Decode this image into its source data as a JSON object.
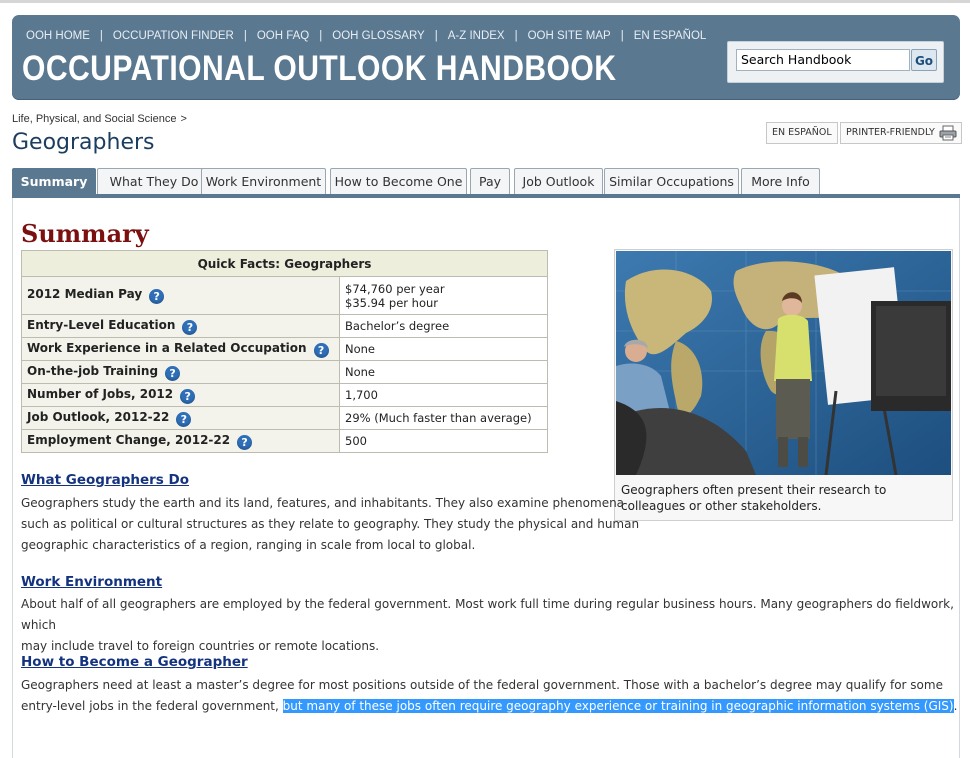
{
  "header": {
    "nav": [
      {
        "label": "OOH HOME"
      },
      {
        "label": "OCCUPATION FINDER"
      },
      {
        "label": "OOH FAQ"
      },
      {
        "label": "OOH GLOSSARY"
      },
      {
        "label": "A-Z INDEX"
      },
      {
        "label": "OOH SITE MAP"
      },
      {
        "label": "EN ESPAÑOL"
      }
    ],
    "separator": "|",
    "title": "OCCUPATIONAL OUTLOOK HANDBOOK",
    "search": {
      "value": "Search Handbook",
      "button": "Go"
    }
  },
  "breadcrumb": {
    "item": "Life, Physical, and Social Science",
    "sep": ">"
  },
  "page_title": "Geographers",
  "tools": {
    "espanol": "EN ESPAÑOL",
    "printer": "PRINTER-FRIENDLY"
  },
  "tabs": [
    {
      "label": "Summary"
    },
    {
      "label": "What They Do"
    },
    {
      "label": "Work Environment"
    },
    {
      "label": "How to Become One"
    },
    {
      "label": "Pay"
    },
    {
      "label": "Job Outlook"
    },
    {
      "label": "Similar Occupations"
    },
    {
      "label": "More Info"
    }
  ],
  "summary_heading": "Summary",
  "quick_facts": {
    "title": "Quick Facts: Geographers",
    "rows": [
      {
        "label": "2012 Median Pay",
        "value": "$74,760 per year",
        "value2": "$35.94 per hour"
      },
      {
        "label": "Entry-Level Education",
        "value": "Bachelor’s degree"
      },
      {
        "label": "Work Experience in a Related Occupation",
        "value": "None"
      },
      {
        "label": "On-the-job Training",
        "value": "None"
      },
      {
        "label": "Number of Jobs, 2012",
        "value": "1,700"
      },
      {
        "label": "Job Outlook, 2012-22",
        "value": "29% (Much faster than average)"
      },
      {
        "label": "Employment Change, 2012-22",
        "value": "500"
      }
    ],
    "help_glyph": "?"
  },
  "figure": {
    "caption": "Geographers often present their research to colleagues or other stakeholders."
  },
  "sections": {
    "what_they_do": {
      "heading": "What Geographers Do",
      "lines": [
        "Geographers study the earth and its land, features, and inhabitants. They also examine phenomena",
        "such as political or cultural structures as they relate to geography. They study the physical and human",
        "geographic characteristics of a region, ranging in scale from local to global."
      ]
    },
    "work_environment": {
      "heading": "Work Environment",
      "lines": [
        "About half of all geographers are employed by the federal government. Most work full time during regular business hours. Many geographers do fieldwork, which",
        "may include travel to foreign countries or remote locations."
      ]
    },
    "how_to_become": {
      "heading": "How to Become a Geographer",
      "line1": "Geographers need at least a master’s degree for most positions outside of the federal government. Those with a bachelor’s degree may qualify for some",
      "line2_plain": "entry-level jobs in the federal government, ",
      "line2_selected": "but many of these jobs often require geography experience or training in geographic information systems (GIS)",
      "line2_end": "."
    }
  },
  "colors": {
    "banner": "#5a7890",
    "heading": "#7a1010",
    "link": "#14337f",
    "selection": "#3399ff"
  }
}
